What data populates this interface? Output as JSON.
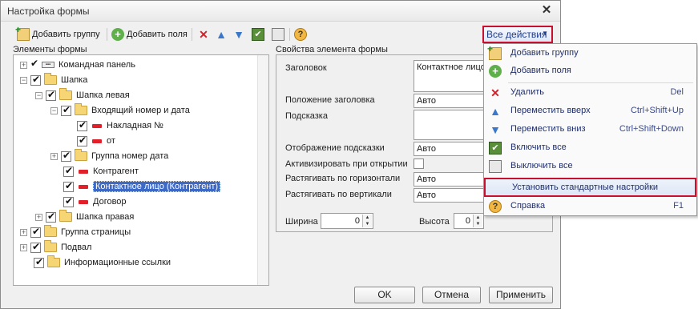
{
  "window": {
    "title": "Настройка формы"
  },
  "toolbar": {
    "add_group": "Добавить группу",
    "add_fields": "Добавить поля",
    "all_actions": "Все действия"
  },
  "left_panel": {
    "title": "Элементы формы"
  },
  "tree": [
    {
      "label": "Командная панель"
    },
    {
      "label": "Шапка"
    },
    {
      "label": "Шапка левая"
    },
    {
      "label": "Входящий номер и дата"
    },
    {
      "label": "Накладная №"
    },
    {
      "label": "от"
    },
    {
      "label": "Группа номер дата"
    },
    {
      "label": "Контрагент"
    },
    {
      "label": "Контактное лицо (Контрагент)"
    },
    {
      "label": "Договор"
    },
    {
      "label": "Шапка правая"
    },
    {
      "label": "Группа страницы"
    },
    {
      "label": "Подвал"
    },
    {
      "label": "Информационные ссылки"
    }
  ],
  "props": {
    "title": "Свойства элемента формы",
    "title_label": "Заголовок",
    "title_value": "Контактное лицо",
    "title_pos_label": "Положение заголовка",
    "title_pos_value": "Авто",
    "hint_label": "Подсказка",
    "hint_display_label": "Отображение подсказки",
    "hint_display_value": "Авто",
    "activate_label": "Активизировать при открытии",
    "stretch_h_label": "Растягивать по горизонтали",
    "stretch_h_value": "Авто",
    "stretch_v_label": "Растягивать по вертикали",
    "stretch_v_value": "Авто",
    "width_label": "Ширина",
    "width_value": "0",
    "height_label": "Высота",
    "height_value": "0"
  },
  "buttons": {
    "ok": "OK",
    "cancel": "Отмена",
    "apply": "Применить"
  },
  "menu": {
    "items": [
      {
        "label": "Добавить группу",
        "shortcut": ""
      },
      {
        "label": "Добавить поля",
        "shortcut": ""
      },
      {
        "label": "Удалить",
        "shortcut": "Del"
      },
      {
        "label": "Переместить вверх",
        "shortcut": "Ctrl+Shift+Up"
      },
      {
        "label": "Переместить вниз",
        "shortcut": "Ctrl+Shift+Down"
      },
      {
        "label": "Включить все",
        "shortcut": ""
      },
      {
        "label": "Выключить все",
        "shortcut": ""
      },
      {
        "label": "Установить стандартные настройки",
        "shortcut": ""
      },
      {
        "label": "Справка",
        "shortcut": "F1"
      }
    ]
  },
  "colors": {
    "selection": "#3d69c7",
    "highlight_border": "#c8102e",
    "menu_text": "#1f2f6b"
  }
}
